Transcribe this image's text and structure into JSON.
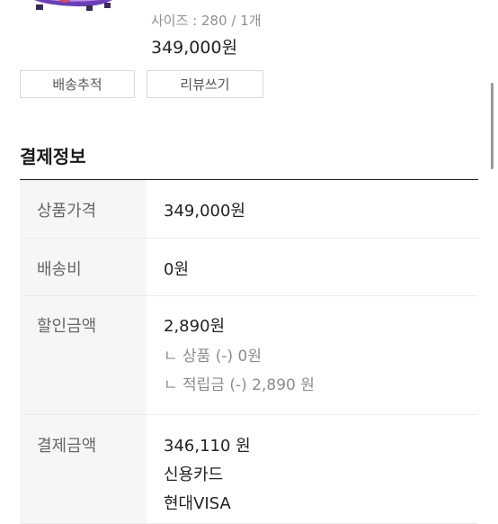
{
  "order_item": {
    "image": "soccer-cleats-product-image",
    "option": "사이즈 : 280 / 1개",
    "price": "349,000원"
  },
  "buttons": {
    "track": "배송추적",
    "review": "리뷰쓰기"
  },
  "payment": {
    "title": "결제정보",
    "product_price_label": "상품가격",
    "product_price_value": "349,000원",
    "shipping_label": "배송비",
    "shipping_value": "0원",
    "discount_label": "할인금액",
    "discount_value": "2,890원",
    "discount_product": "ㄴ 상품 (-) 0원",
    "discount_points": "ㄴ 적립금 (-) 2,890 원",
    "total_label": "결제금액",
    "total_value": "346,110 원",
    "method": "신용카드",
    "card": "현대VISA"
  }
}
